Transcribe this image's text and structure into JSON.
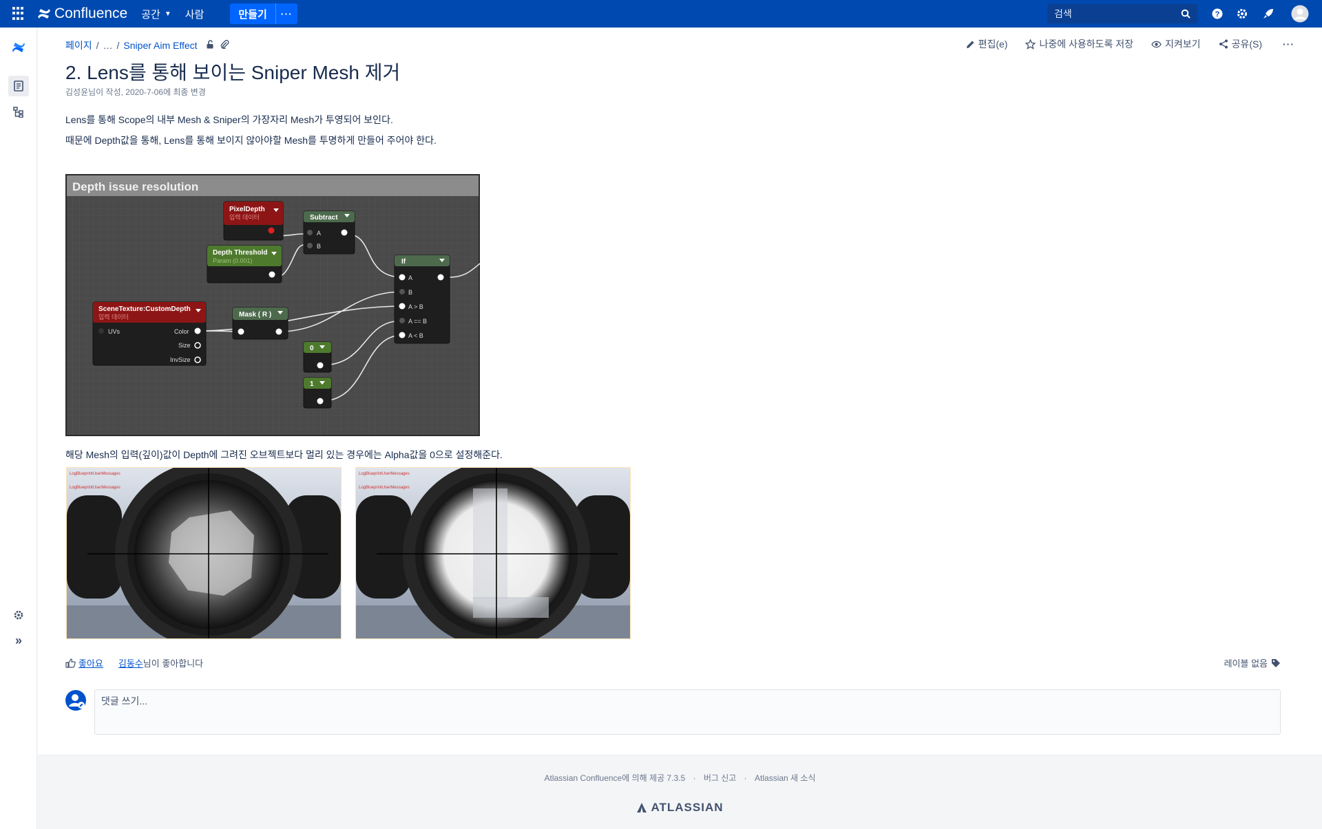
{
  "topbar": {
    "app_name": "Confluence",
    "nav_spaces": "공간",
    "nav_people": "사람",
    "create_label": "만들기",
    "more_label": "···",
    "search_placeholder": "검색"
  },
  "breadcrumb": {
    "root": "페이지",
    "ellipsis": "…",
    "parent": "Sniper Aim Effect"
  },
  "page_actions": {
    "edit_label": "편집(e)",
    "save_later_label": "나중에 사용하도록 저장",
    "watch_label": "지켜보기",
    "share_label": "공유(S)",
    "more_label": "···"
  },
  "page": {
    "title": "2. Lens를 통해 보이는 Sniper Mesh 제거",
    "byline": "김성윤님이 작성, 2020-7-06에 최종 변경",
    "para1": "Lens를 통해 Scope의 내부 Mesh & Sniper의 가장자리 Mesh가 투영되어 보인다.",
    "para2": "때문에 Depth값을 통해, Lens를 통해 보이지 않아야할 Mesh를 투명하게 만들어 주어야 한다.",
    "para3": "해당 Mesh의 입력(깊이)값이 Depth에 그려진 오브젝트보다 멀리 있는 경우에는 Alpha값을 0으로 설정해준다."
  },
  "node_graph": {
    "header": "Depth issue resolution",
    "pixel_depth": "PixelDepth",
    "pixel_depth_sub": "입력 데이터",
    "subtract": "Subtract",
    "pin_a": "A",
    "pin_b": "B",
    "depth_threshold": "Depth Threshold",
    "depth_threshold_sub": "Param (0.001)",
    "if_node": "If",
    "if_pins": [
      "A",
      "B",
      "A > B",
      "A == B",
      "A < B"
    ],
    "scene_texture": "SceneTexture:CustomDepth",
    "scene_texture_sub": "입력 데이터",
    "uvs": "UVs",
    "color": "Color",
    "size": "Size",
    "invsize": "InvSize",
    "mask": "Mask ( R )",
    "const0": "0",
    "const1": "1"
  },
  "likes": {
    "like_label": "좋아요",
    "liker": "김동수",
    "liked_suffix": "님이 좋아합니다"
  },
  "labels_text": "레이블 없음",
  "comment_placeholder": "댓글 쓰기...",
  "footer": {
    "powered": "Atlassian Confluence에 의해 제공 7.3.5",
    "bug": "버그 신고",
    "news": "Atlassian 새 소식",
    "logo": "ATLASSIAN"
  },
  "colors": {
    "topbar": "#0049b0",
    "create_button": "#0065ff",
    "link": "#0052cc"
  }
}
